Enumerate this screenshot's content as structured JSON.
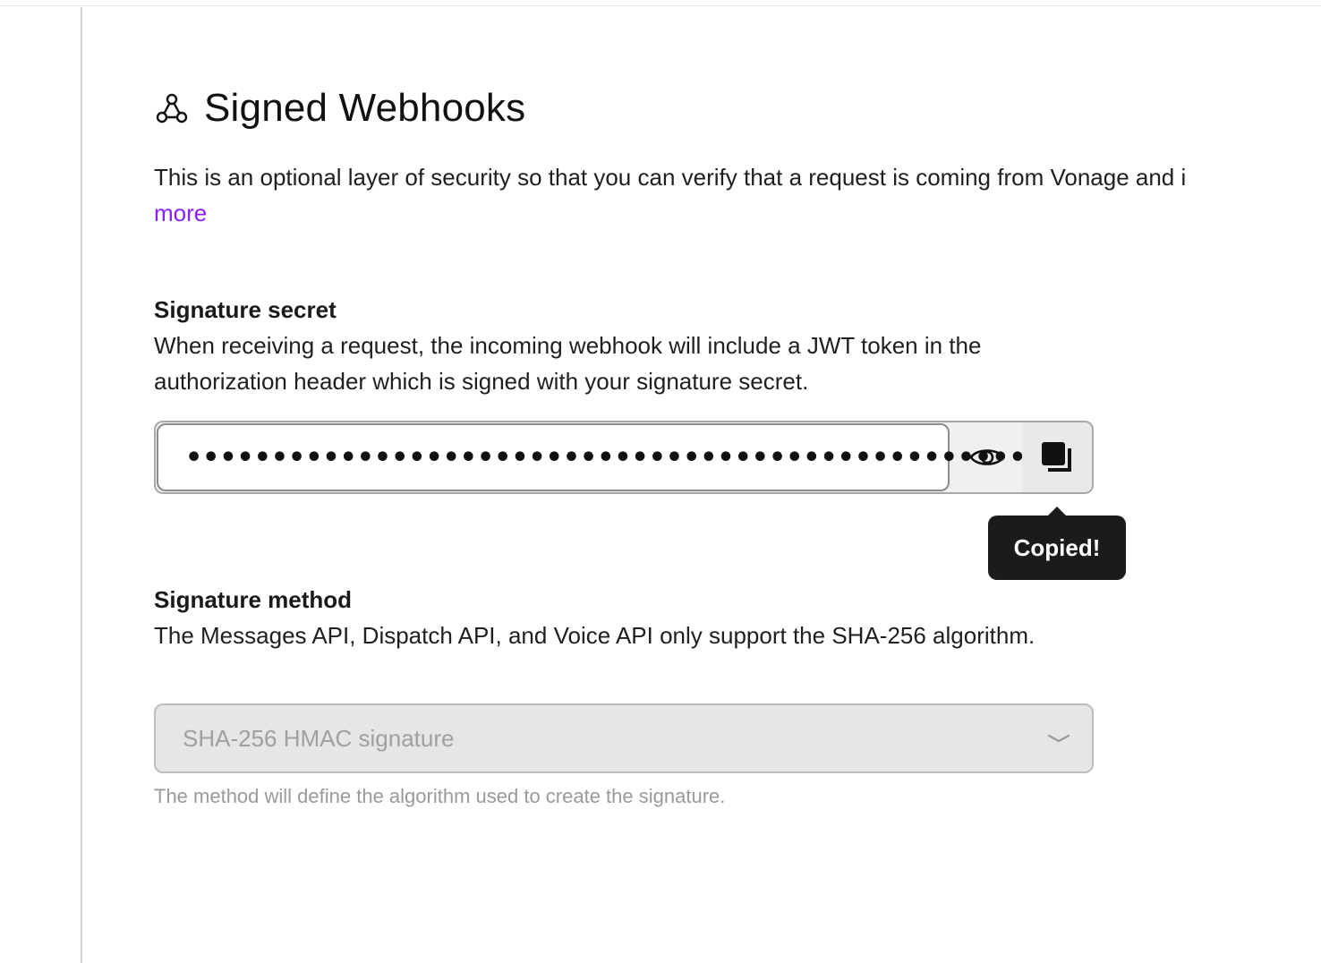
{
  "section": {
    "title": "Signed Webhooks",
    "icon": "webhook-icon",
    "intro_text": "This is an optional layer of security so that you can verify that a request is coming from Vonage and i",
    "learn_more_label": "more",
    "accent_color": "#871eff"
  },
  "signature_secret": {
    "label": "Signature secret",
    "description": "When receiving a request, the incoming webhook will include a JWT token in the authorization header which is signed with your signature secret.",
    "masked_value": "••••••••••••••••••••••••••••••••••••••••••••••••••",
    "reveal_icon": "eye-icon",
    "copy_icon": "copy-icon",
    "tooltip": "Copied!"
  },
  "signature_method": {
    "label": "Signature method",
    "description": "The Messages API, Dispatch API, and Voice API only support the SHA-256 algorithm.",
    "selected": "SHA-256 HMAC signature",
    "helper": "The method will define the algorithm used to create the signature."
  }
}
